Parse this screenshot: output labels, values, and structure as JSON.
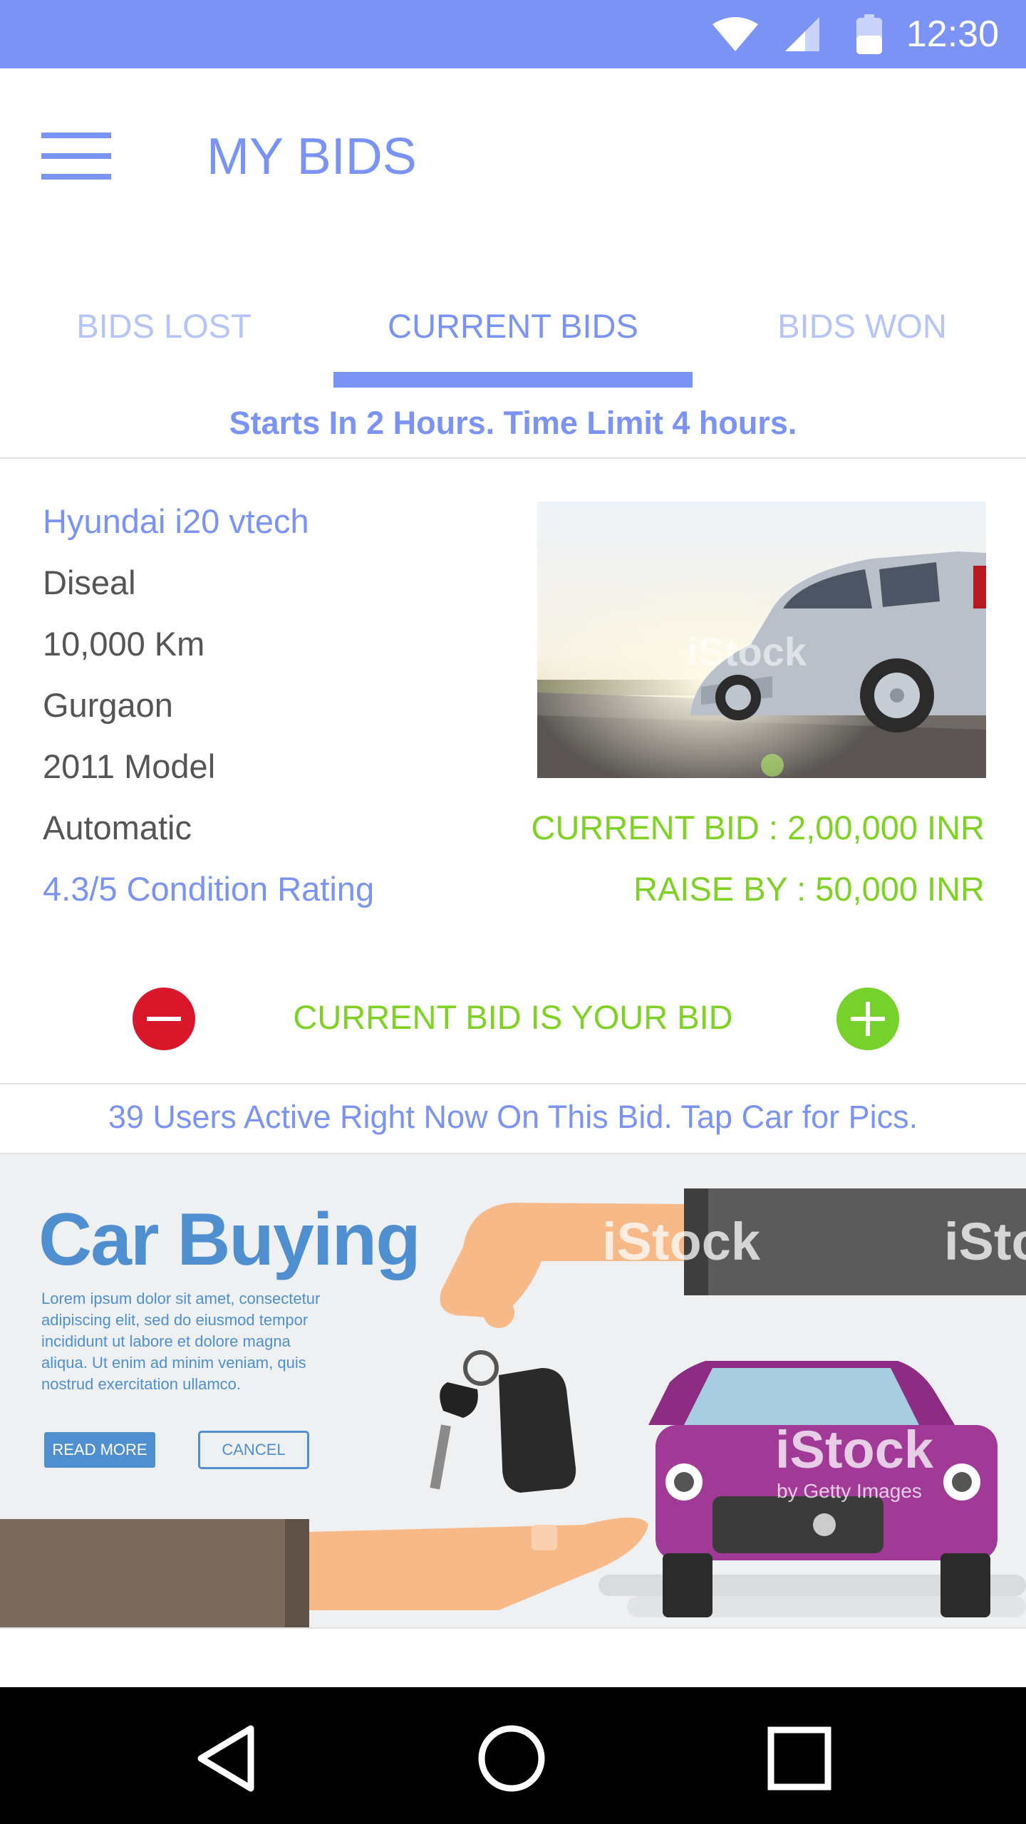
{
  "status_bar": {
    "time": "12:30",
    "icons": [
      "wifi-icon",
      "signal-icon",
      "battery-icon"
    ],
    "color": "#7b93f4"
  },
  "app_bar": {
    "title": "MY BIDS",
    "menu_icon": "hamburger-menu-icon"
  },
  "tabs": [
    {
      "label": "BIDS LOST",
      "active": false
    },
    {
      "label": "CURRENT BIDS",
      "active": true
    },
    {
      "label": "BIDS WON",
      "active": false
    }
  ],
  "notice": "Starts In 2 Hours. Time Limit 4 hours.",
  "listing": {
    "name": "Hyundai i20 vtech",
    "fuel": "Diseal",
    "distance": "10,000 Km",
    "location": "Gurgaon",
    "model": "2011 Model",
    "transmission": "Automatic",
    "rating": "4.3/5 Condition Rating",
    "current_bid": "CURRENT BID : 2,00,000 INR",
    "raise_by": "RAISE BY : 50,000 INR",
    "bid_status": "CURRENT BID IS YOUR BID",
    "decrease_icon": "minus-icon",
    "increase_icon": "plus-icon"
  },
  "users_active": "39 Users Active Right Now On This Bid. Tap Car for Pics.",
  "banner": {
    "title": "Car Buying",
    "text": "Lorem ipsum dolor sit amet, consectetur adipiscing elit, sed do eiusmod tempor incididunt ut labore et dolore magna aliqua. Ut enim ad minim veniam, quis nostrud exercitation ullamco.",
    "read_more": "READ MORE",
    "cancel": "CANCEL",
    "watermark": "iStock",
    "watermark_sub": "by Getty Images"
  },
  "nav_bar": {
    "icons": [
      "back-icon",
      "home-icon",
      "recent-apps-icon"
    ]
  },
  "colors": {
    "primary": "#7b93f4",
    "green": "#7fd124",
    "red": "#d9172a",
    "banner_blue": "#4f8fd0"
  }
}
